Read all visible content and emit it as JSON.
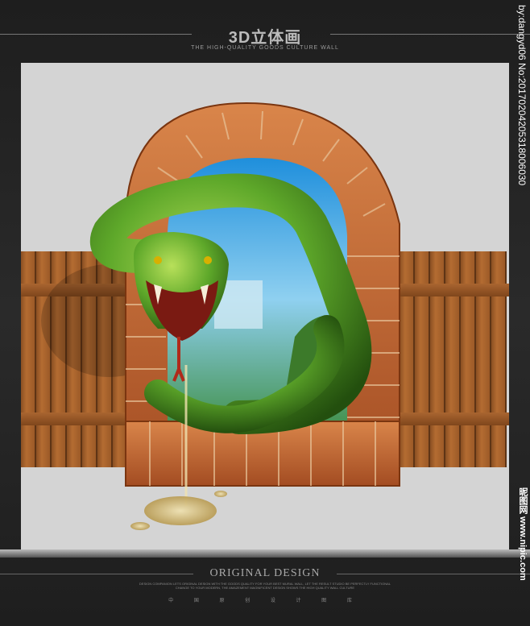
{
  "header": {
    "title": "3D立体画",
    "subtitle": "THE HIGH-QUALITY GOODS CULTURE WALL"
  },
  "footer": {
    "title": "ORIGINAL DESIGN",
    "tagline": "DESIGN COMPANION LETS ORIGINAL DESIGN WITH THE GOODS QUALITY FOR YOUR BEST MURAL WALL, LET THE RESULT STUDIO BE PERFECTLY FUNCTIONAL CHANGE TO YOUR MODERN, THE AMAZEMENT MAGNIFICENT DESIGN SHOWS THE HIGH QUALITY WALL CULTURE",
    "chinese_line": "中 国 原 创 设 计 图 库"
  },
  "watermark": {
    "vertical_top": "by:dangyd06 No:20170204205318006030",
    "vertical_bottom": "昵图网 www.nipic.com"
  },
  "colors": {
    "background": "#222222",
    "canvas": "#d4d4d4",
    "brick": "#b4582a",
    "wood": "#9c5a27",
    "snake": "#4f9a1e"
  }
}
